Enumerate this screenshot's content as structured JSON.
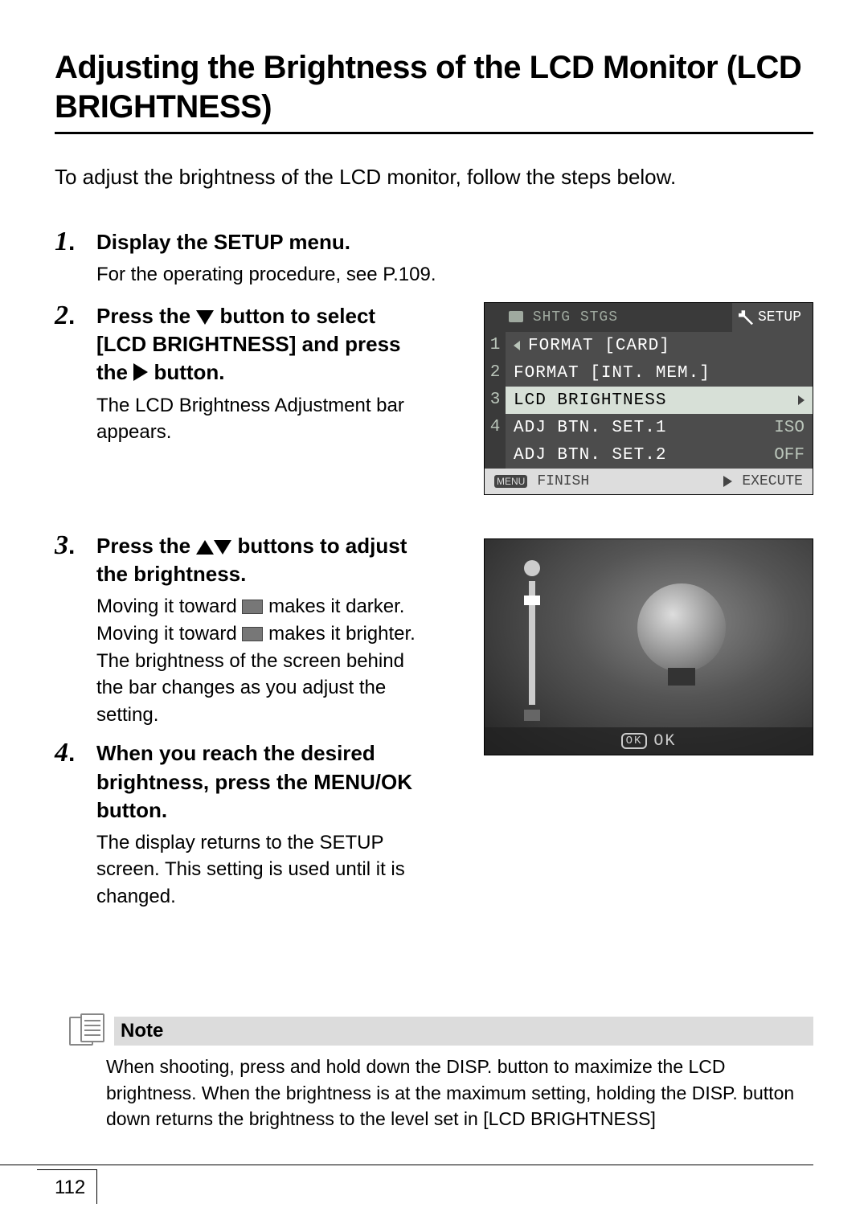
{
  "title": "Adjusting the Brightness of the LCD Monitor (LCD BRIGHTNESS)",
  "intro": "To adjust the brightness of the LCD monitor, follow the steps below.",
  "steps": {
    "s1": {
      "num": "1",
      "head": "Display the SETUP menu.",
      "desc": "For the operating procedure, see P.109."
    },
    "s2": {
      "num": "2",
      "head_a": "Press the ",
      "head_b": " button to select [LCD BRIGHTNESS] and press the ",
      "head_c": " button.",
      "desc": "The LCD Brightness Adjustment bar appears."
    },
    "s3": {
      "num": "3",
      "head_a": "Press the ",
      "head_b": " buttons to adjust the brightness.",
      "desc_a": "Moving it toward ",
      "desc_b": " makes it darker. Moving it toward ",
      "desc_c": " makes it brighter. The brightness of the screen behind the bar changes as you adjust the setting."
    },
    "s4": {
      "num": "4",
      "head_a": "When you reach the desired brightness, press the ",
      "head_btn": "MENU/OK",
      "head_b": " button.",
      "desc": "The display returns to the SETUP screen. This setting is used until it is changed."
    }
  },
  "screen1": {
    "tab_left": "SHTG STGS",
    "tab_right": "SETUP",
    "rows": [
      {
        "n": "1",
        "label": "FORMAT [CARD]",
        "val": ""
      },
      {
        "n": "2",
        "label": "FORMAT [INT. MEM.]",
        "val": ""
      },
      {
        "n": "3",
        "label": "LCD BRIGHTNESS",
        "val": ""
      },
      {
        "n": "4",
        "label": "ADJ BTN. SET.1",
        "val": "ISO"
      },
      {
        "n": "",
        "label": "ADJ BTN. SET.2",
        "val": "OFF"
      }
    ],
    "foot_menu": "MENU",
    "foot_left": "FINISH",
    "foot_right": "EXECUTE"
  },
  "screen2": {
    "ok": "OK"
  },
  "note": {
    "label": "Note",
    "text": "When shooting, press and hold down the DISP. button to maximize the LCD brightness. When the brightness is at the maximum setting, holding the DISP. button down returns the brightness to the level set in [LCD BRIGHTNESS]"
  },
  "page": "112"
}
